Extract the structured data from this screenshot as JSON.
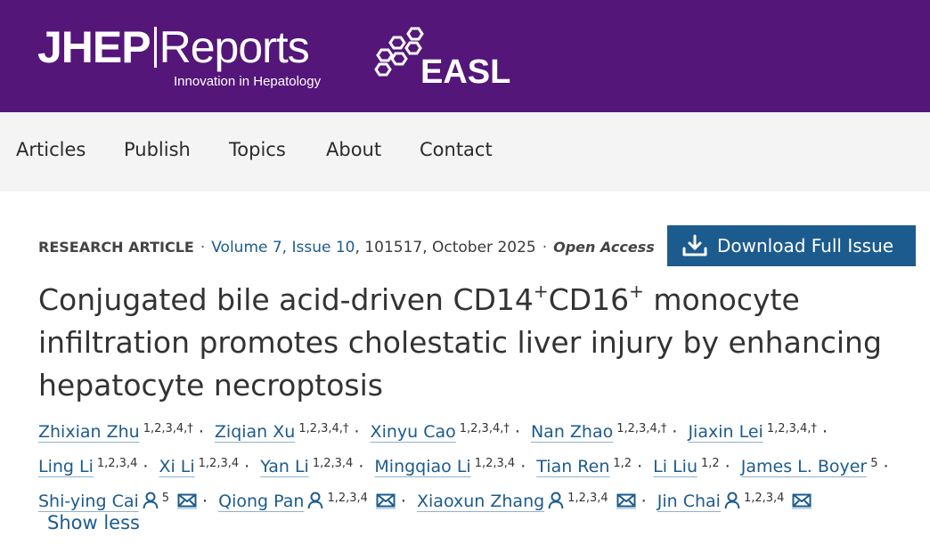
{
  "header": {
    "logo_bold": "JHEP",
    "logo_light": "Reports",
    "logo_tagline": "Innovation in Hepatology",
    "partner": "EASL",
    "colors": {
      "banner": "#541679",
      "link": "#1c5b8e"
    }
  },
  "nav": [
    "Articles",
    "Publish",
    "Topics",
    "About",
    "Contact"
  ],
  "meta": {
    "type": "RESEARCH ARTICLE",
    "volume_issue": "Volume 7, Issue 10",
    "details": ", 101517, October 2025",
    "access": "Open Access"
  },
  "download_button": {
    "label": "Download Full Issue",
    "icon": "download-icon"
  },
  "title": {
    "part1": "Conjugated bile acid-driven CD14",
    "sup1": "+",
    "part2": "CD16",
    "sup2": "+",
    "part3": " monocyte infiltration promotes cholestatic liver injury by enhancing hepatocyte necroptosis"
  },
  "authors": [
    {
      "name": "Zhixian Zhu",
      "aff": "1,2,3,4,†"
    },
    {
      "name": "Ziqian Xu",
      "aff": "1,2,3,4,†"
    },
    {
      "name": "Xinyu Cao",
      "aff": "1,2,3,4,†"
    },
    {
      "name": "Nan Zhao",
      "aff": "1,2,3,4,†"
    },
    {
      "name": "Jiaxin Lei",
      "aff": "1,2,3,4,†"
    },
    {
      "name": "Ling Li",
      "aff": "1,2,3,4"
    },
    {
      "name": "Xi Li",
      "aff": "1,2,3,4"
    },
    {
      "name": "Yan Li",
      "aff": "1,2,3,4"
    },
    {
      "name": "Mingqiao Li",
      "aff": "1,2,3,4"
    },
    {
      "name": "Tian Ren",
      "aff": "1,2"
    },
    {
      "name": "Li Liu",
      "aff": "1,2"
    },
    {
      "name": "James L. Boyer",
      "aff": "5"
    },
    {
      "name": "Shi-ying Cai",
      "aff": "5",
      "corresponding": true
    },
    {
      "name": "Qiong Pan",
      "aff": "1,2,3,4",
      "corresponding": true
    },
    {
      "name": "Xiaoxun Zhang",
      "aff": "1,2,3,4",
      "corresponding": true
    },
    {
      "name": "Jin Chai",
      "aff": "1,2,3,4",
      "corresponding": true
    }
  ],
  "show_less": "Show less"
}
